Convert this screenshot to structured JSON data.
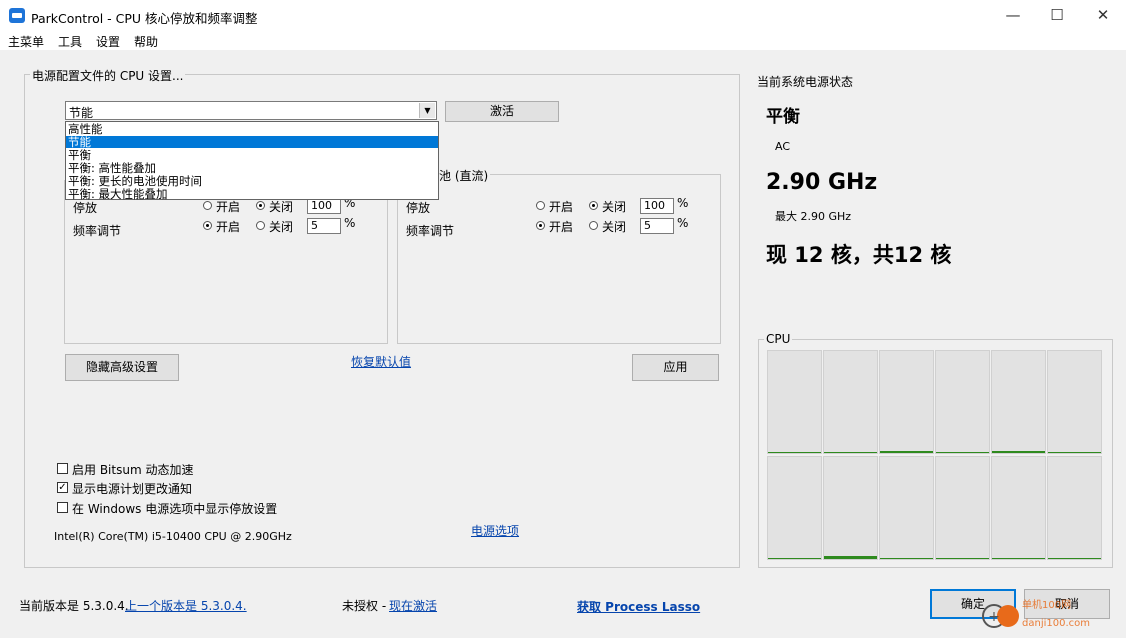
{
  "window": {
    "title": "ParkControl - CPU 核心停放和频率调整",
    "minimize": "—",
    "maximize": "☐",
    "close": "✕"
  },
  "menu": [
    "主菜单",
    "工具",
    "设置",
    "帮助"
  ],
  "profile_group": {
    "label": "电源配置文件的 CPU 设置...",
    "selected": "节能",
    "activate_button": "激活",
    "dropdown_options": [
      "高性能",
      "节能",
      "平衡",
      "平衡: 高性能叠加",
      "平衡: 更长的电池使用时间",
      "平衡: 最大性能叠加"
    ],
    "dropdown_highlight_index": 1
  },
  "ac_panel": {
    "park_label": "停放",
    "freq_label": "频率调节",
    "on": "开启",
    "off": "关闭",
    "park_value": "100",
    "freq_value": "5",
    "pct": "%"
  },
  "dc_panel": {
    "label": "池 (直流)",
    "park_label": "停放",
    "freq_label": "频率调节",
    "on": "开启",
    "off": "关闭",
    "park_value": "100",
    "freq_value": "5",
    "pct": "%"
  },
  "buttons": {
    "hide_advanced": "隐藏高级设置",
    "restore_defaults": "恢复默认值",
    "apply": "应用",
    "ok": "确定",
    "cancel": "取消"
  },
  "options": {
    "bitsum": "启用 Bitsum 动态加速",
    "notify": "显示电源计划更改通知",
    "show_in_windows": "在 Windows 电源选项中显示停放设置",
    "bitsum_checked": false,
    "notify_checked": true,
    "show_checked": false
  },
  "cpu_name": "Intel(R) Core(TM) i5-10400 CPU @ 2.90GHz",
  "power_options_link": "电源选项",
  "status": {
    "heading": "当前系统电源状态",
    "plan": "平衡",
    "source": "AC",
    "freq": "2.90 GHz",
    "max": "最大 2.90 GHz",
    "cores": "现 12 核，共12 核",
    "cpu_label": "CPU",
    "core_usage": [
      0,
      0,
      0.02,
      0,
      0.02,
      0,
      0,
      0.03,
      0,
      0,
      0,
      0
    ]
  },
  "footer": {
    "version": "当前版本是 5.3.0.4.",
    "prev_version": "上一个版本是 5.3.0.4.",
    "unlicensed": "未授权 -",
    "activate_now": "现在激活",
    "get_lasso": "获取 Process Lasso"
  },
  "watermark": "单机100网 danji100.com",
  "colors": {
    "accent": "#0078d7",
    "bar": "#2e8a1e",
    "link": "#0645ad"
  }
}
